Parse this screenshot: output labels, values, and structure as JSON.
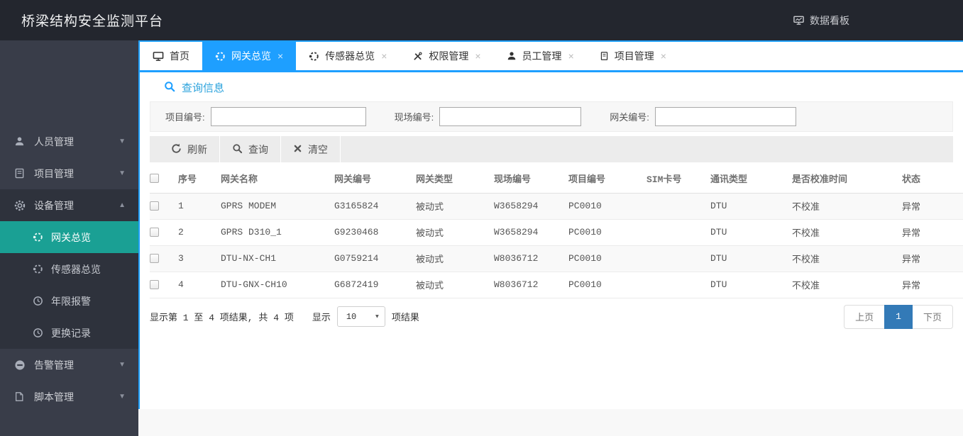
{
  "app": {
    "title": "桥梁结构安全监测平台",
    "dashboard_link": "数据看板"
  },
  "icons": {
    "caret_down": "▼",
    "caret_up": "▲",
    "close": "×",
    "select_arrow": "▼"
  },
  "sidebar": {
    "items": {
      "personnel": "人员管理",
      "project": "项目管理",
      "device": "设备管理",
      "alarm": "告警管理",
      "script": "脚本管理"
    },
    "device_children": {
      "gateway": "网关总览",
      "sensor": "传感器总览",
      "lifetime": "年限报警",
      "replace": "更换记录"
    }
  },
  "tabs": [
    {
      "label": "首页"
    },
    {
      "label": "网关总览"
    },
    {
      "label": "传感器总览"
    },
    {
      "label": "权限管理"
    },
    {
      "label": "员工管理"
    },
    {
      "label": "项目管理"
    }
  ],
  "query": {
    "title": "查询信息",
    "fields": [
      {
        "label": "项目编号:",
        "value": ""
      },
      {
        "label": "现场编号:",
        "value": ""
      },
      {
        "label": "网关编号:",
        "value": ""
      }
    ]
  },
  "toolbar": {
    "refresh": "刷新",
    "search": "查询",
    "clear": "清空"
  },
  "table": {
    "columns": [
      "序号",
      "网关名称",
      "网关编号",
      "网关类型",
      "现场编号",
      "项目编号",
      "SIM卡号",
      "通讯类型",
      "是否校准时间",
      "状态"
    ],
    "rows": [
      {
        "seq": "1",
        "name": "GPRS MODEM",
        "gateway_no": "G3165824",
        "type": "被动式",
        "site_no": "W3658294",
        "project_no": "PC0010",
        "sim": "",
        "comm": "DTU",
        "calibrated": "不校准",
        "status": "异常"
      },
      {
        "seq": "2",
        "name": "GPRS D310_1",
        "gateway_no": "G9230468",
        "type": "被动式",
        "site_no": "W3658294",
        "project_no": "PC0010",
        "sim": "",
        "comm": "DTU",
        "calibrated": "不校准",
        "status": "异常"
      },
      {
        "seq": "3",
        "name": "DTU-NX-CH1",
        "gateway_no": "G0759214",
        "type": "被动式",
        "site_no": "W8036712",
        "project_no": "PC0010",
        "sim": "",
        "comm": "DTU",
        "calibrated": "不校准",
        "status": "异常"
      },
      {
        "seq": "4",
        "name": "DTU-GNX-CH10",
        "gateway_no": "G6872419",
        "type": "被动式",
        "site_no": "W8036712",
        "project_no": "PC0010",
        "sim": "",
        "comm": "DTU",
        "calibrated": "不校准",
        "status": "异常"
      }
    ]
  },
  "pagination": {
    "summary": "显示第 1 至 4 项结果, 共 4 项",
    "show_label": "显示",
    "page_size": "10",
    "unit_label": "项结果",
    "prev": "上页",
    "page": "1",
    "next": "下页"
  },
  "colors": {
    "accent_blue": "#1E9FFF",
    "active_teal": "#1AA094",
    "page_active": "#337AB7",
    "header_bg": "#23262E",
    "sidebar_bg": "#393D49"
  }
}
